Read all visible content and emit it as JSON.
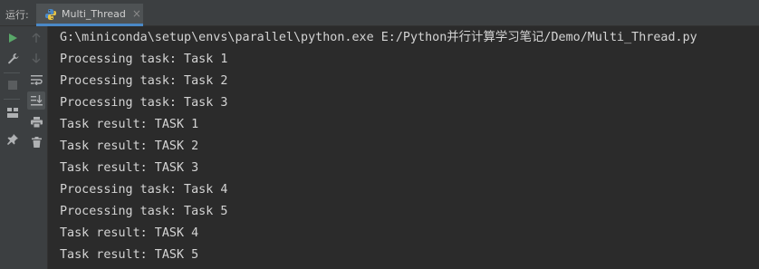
{
  "header": {
    "run_label": "运行:",
    "tab_label": "Multi_Thread",
    "tab_close": "×",
    "tab_icon": "python-icon"
  },
  "toolbar": {
    "left_icons": [
      "run-icon",
      "wrench-icon",
      "stop-icon",
      "layout-icon",
      "pin-icon"
    ],
    "right_icons": [
      "up-arrow-icon",
      "down-arrow-icon",
      "soft-wrap-icon",
      "scroll-to-end-icon",
      "print-icon",
      "trash-icon"
    ]
  },
  "console": {
    "lines": [
      "G:\\miniconda\\setup\\envs\\parallel\\python.exe E:/Python并行计算学习笔记/Demo/Multi_Thread.py",
      "Processing task: Task 1",
      "Processing task: Task 2",
      "Processing task: Task 3",
      "Task result: TASK 1",
      "Task result: TASK 2",
      "Task result: TASK 3",
      "Processing task: Task 4",
      "Processing task: Task 5",
      "Task result: TASK 4",
      "Task result: TASK 5"
    ]
  },
  "colors": {
    "background": "#2b2b2b",
    "toolbar": "#3c3f41",
    "text": "#d4d4d4",
    "run_green": "#59a869",
    "tab_accent": "#4a88c7"
  }
}
